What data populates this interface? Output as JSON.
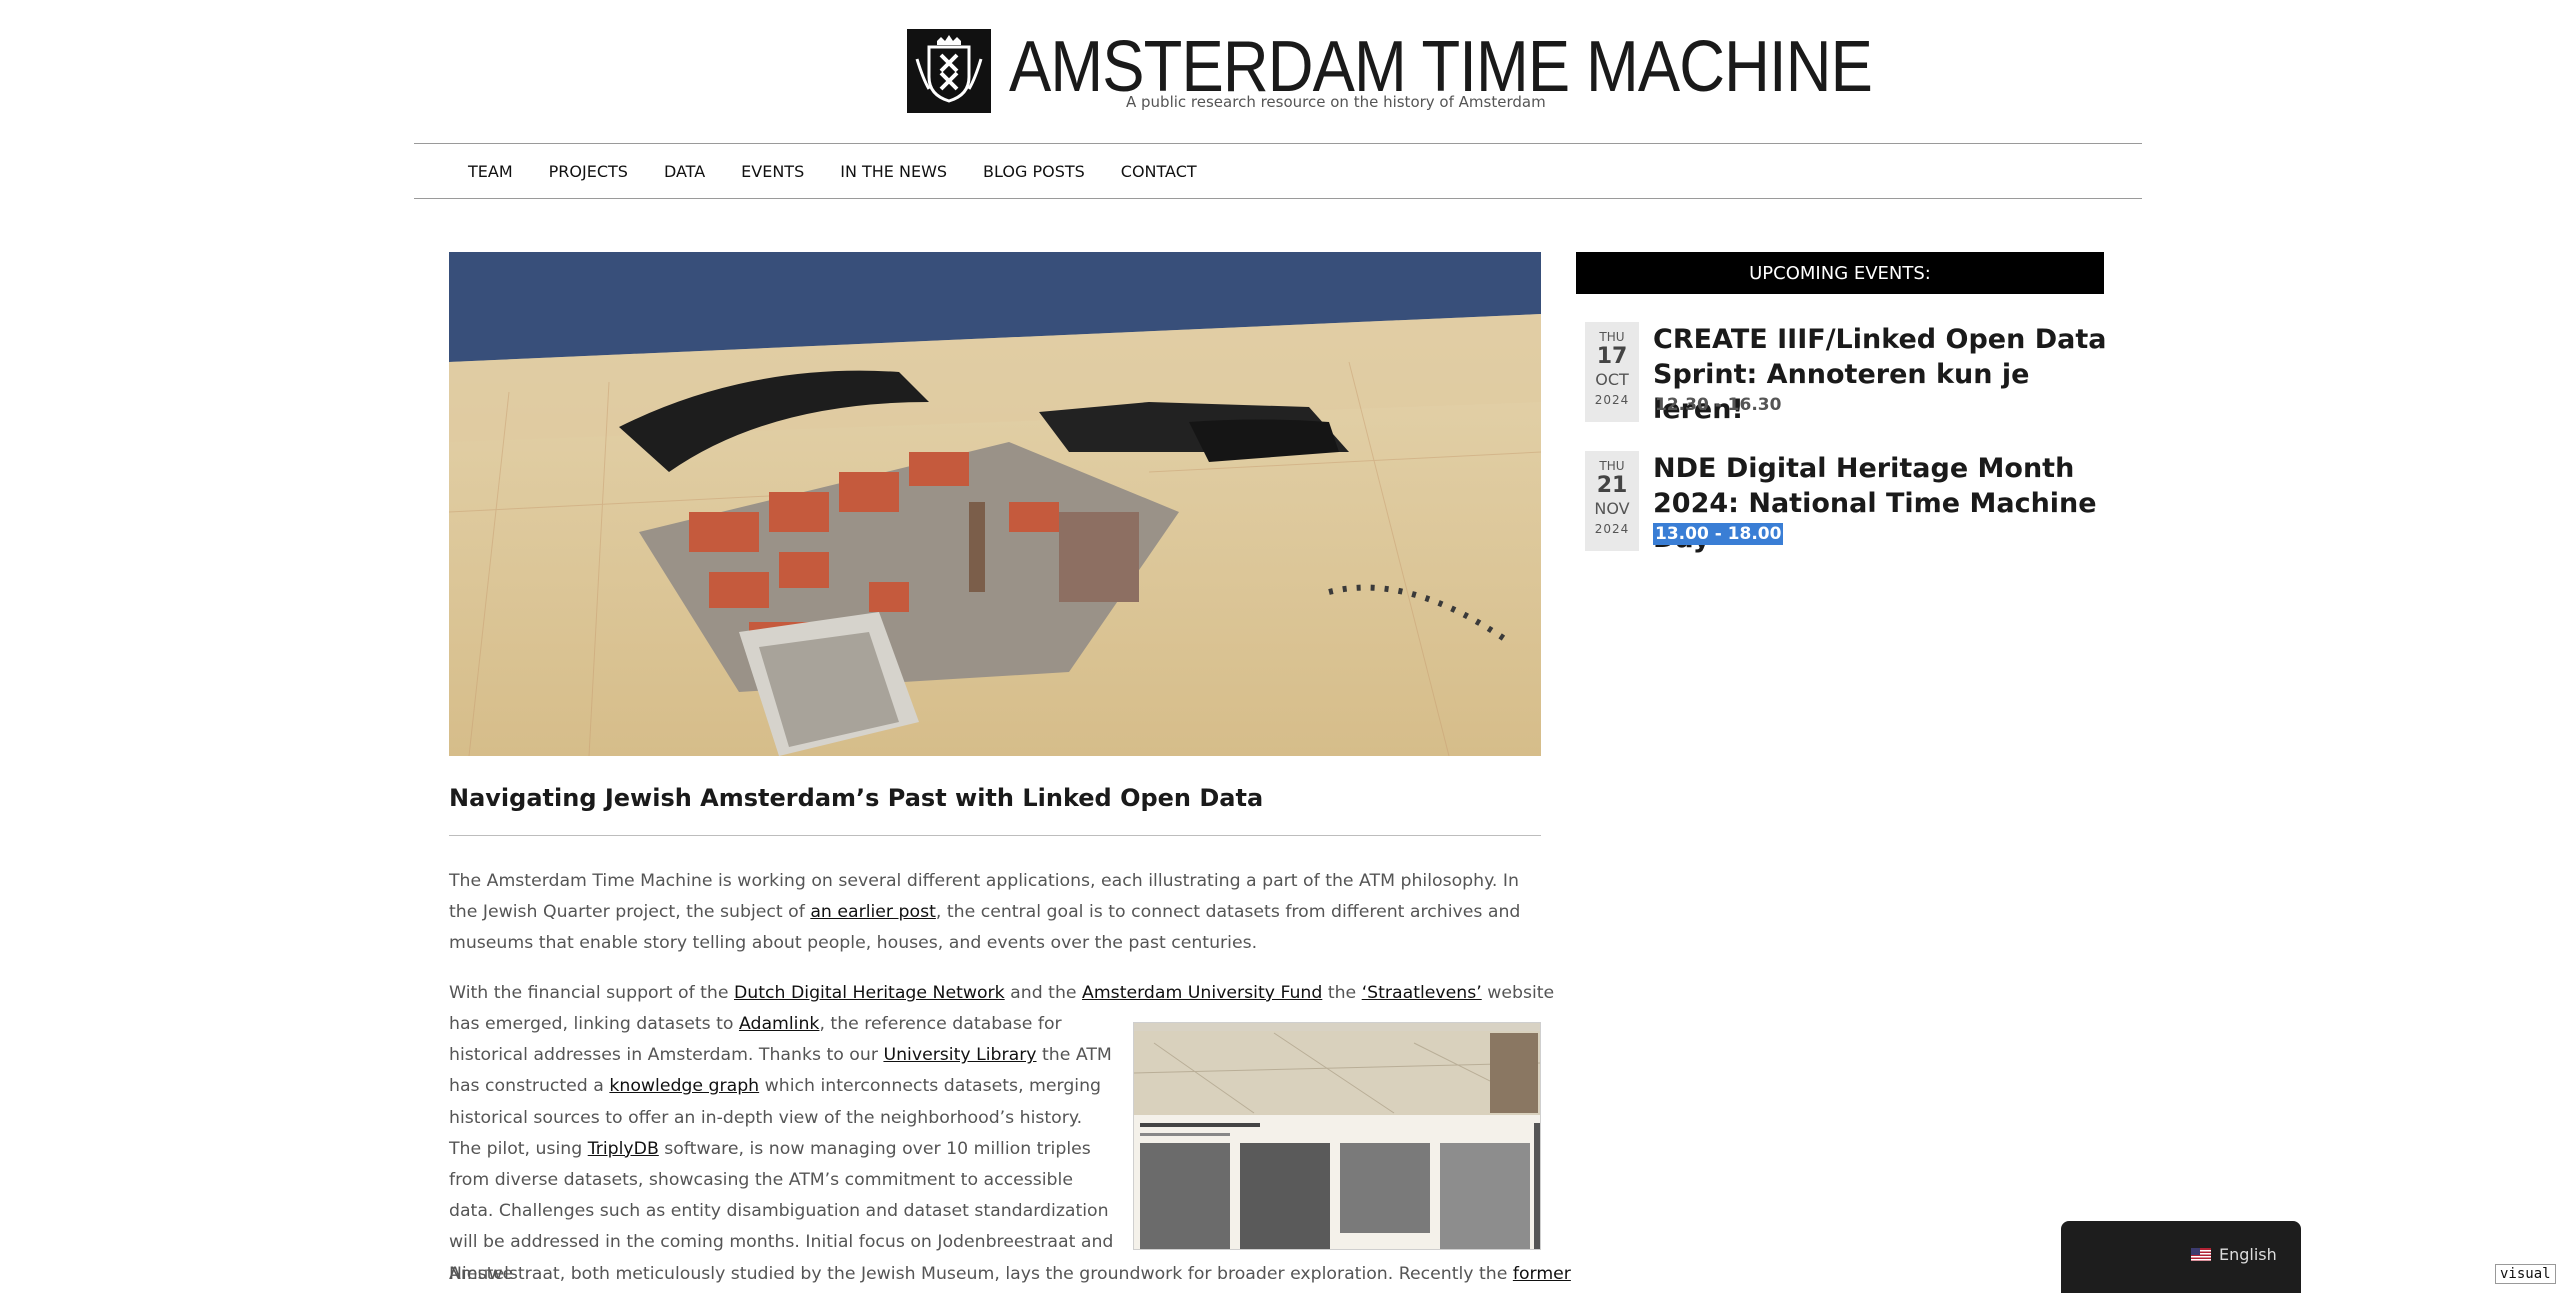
{
  "header": {
    "site_title": "AMSTERDAM TIME MACHINE",
    "tagline": "A public research resource on the history of Amsterdam"
  },
  "nav": {
    "items": [
      "TEAM",
      "PROJECTS",
      "DATA",
      "EVENTS",
      "IN THE NEWS",
      "BLOG POSTS",
      "CONTACT"
    ]
  },
  "article": {
    "title": "Navigating Jewish Amsterdam’s Past with Linked Open Data",
    "p1": {
      "t1": "The Amsterdam Time Machine is working on several different applications, each illustrating a part of the ATM philosophy. In the Jewish Quarter project, the subject of ",
      "link1": "an earlier post",
      "t2": ", the central goal is to connect datasets from different archives and museums that enable story telling about people, houses, and events over the past centuries."
    },
    "p2": {
      "t1": "With the financial support of the ",
      "link1": "Dutch Digital Heritage Network",
      "t2": " and the ",
      "link2": "Amsterdam University Fund",
      "t3": " the ",
      "link3": "‘Straatlevens’",
      "t4": " website",
      "t5": "has emerged, linking datasets to ",
      "link4": "Adamlink",
      "t6": ", the reference database for historical addresses in Amsterdam. Thanks to our ",
      "link5": "University Library",
      "t7": " the ATM has constructed a ",
      "link6": "knowledge graph",
      "t8": " which interconnects datasets, merging historical sources to offer an in-depth view of the neighborhood’s history. The pilot, using ",
      "link7": "TriplyDB",
      "t9": " software, is now managing over 10 million triples from diverse datasets, showcasing the ATM’s commitment to accessible data. Challenges such as entity disambiguation and dataset standardization will be addressed in the coming months. Initial focus on Jodenbreestraat and Nieuwe",
      "t10": "Amstelstraat, both meticulously studied by the Jewish Museum, lays the groundwork for broader exploration. Recently the ",
      "link8": "former"
    }
  },
  "sidebar": {
    "events_header": "UPCOMING EVENTS:",
    "events": [
      {
        "dow": "THU",
        "day": "17",
        "month": "OCT",
        "year": "2024",
        "title": "CREATE IIIF/Linked Open Data Sprint: Annoteren kun je leren!",
        "time": "12.30 - 16.30"
      },
      {
        "dow": "THU",
        "day": "21",
        "month": "NOV",
        "year": "2024",
        "title": "NDE Digital Heritage Month 2024: National Time Machine Day",
        "time": "13.00 - 18.00"
      }
    ]
  },
  "language_widget": {
    "current": "English",
    "flag_icon": "us-flag-icon"
  },
  "debug_tag": "visual",
  "colors": {
    "events_header_bg": "#000000",
    "selection": "#3a7ed5",
    "link": "#111111",
    "body_text": "#555555"
  }
}
